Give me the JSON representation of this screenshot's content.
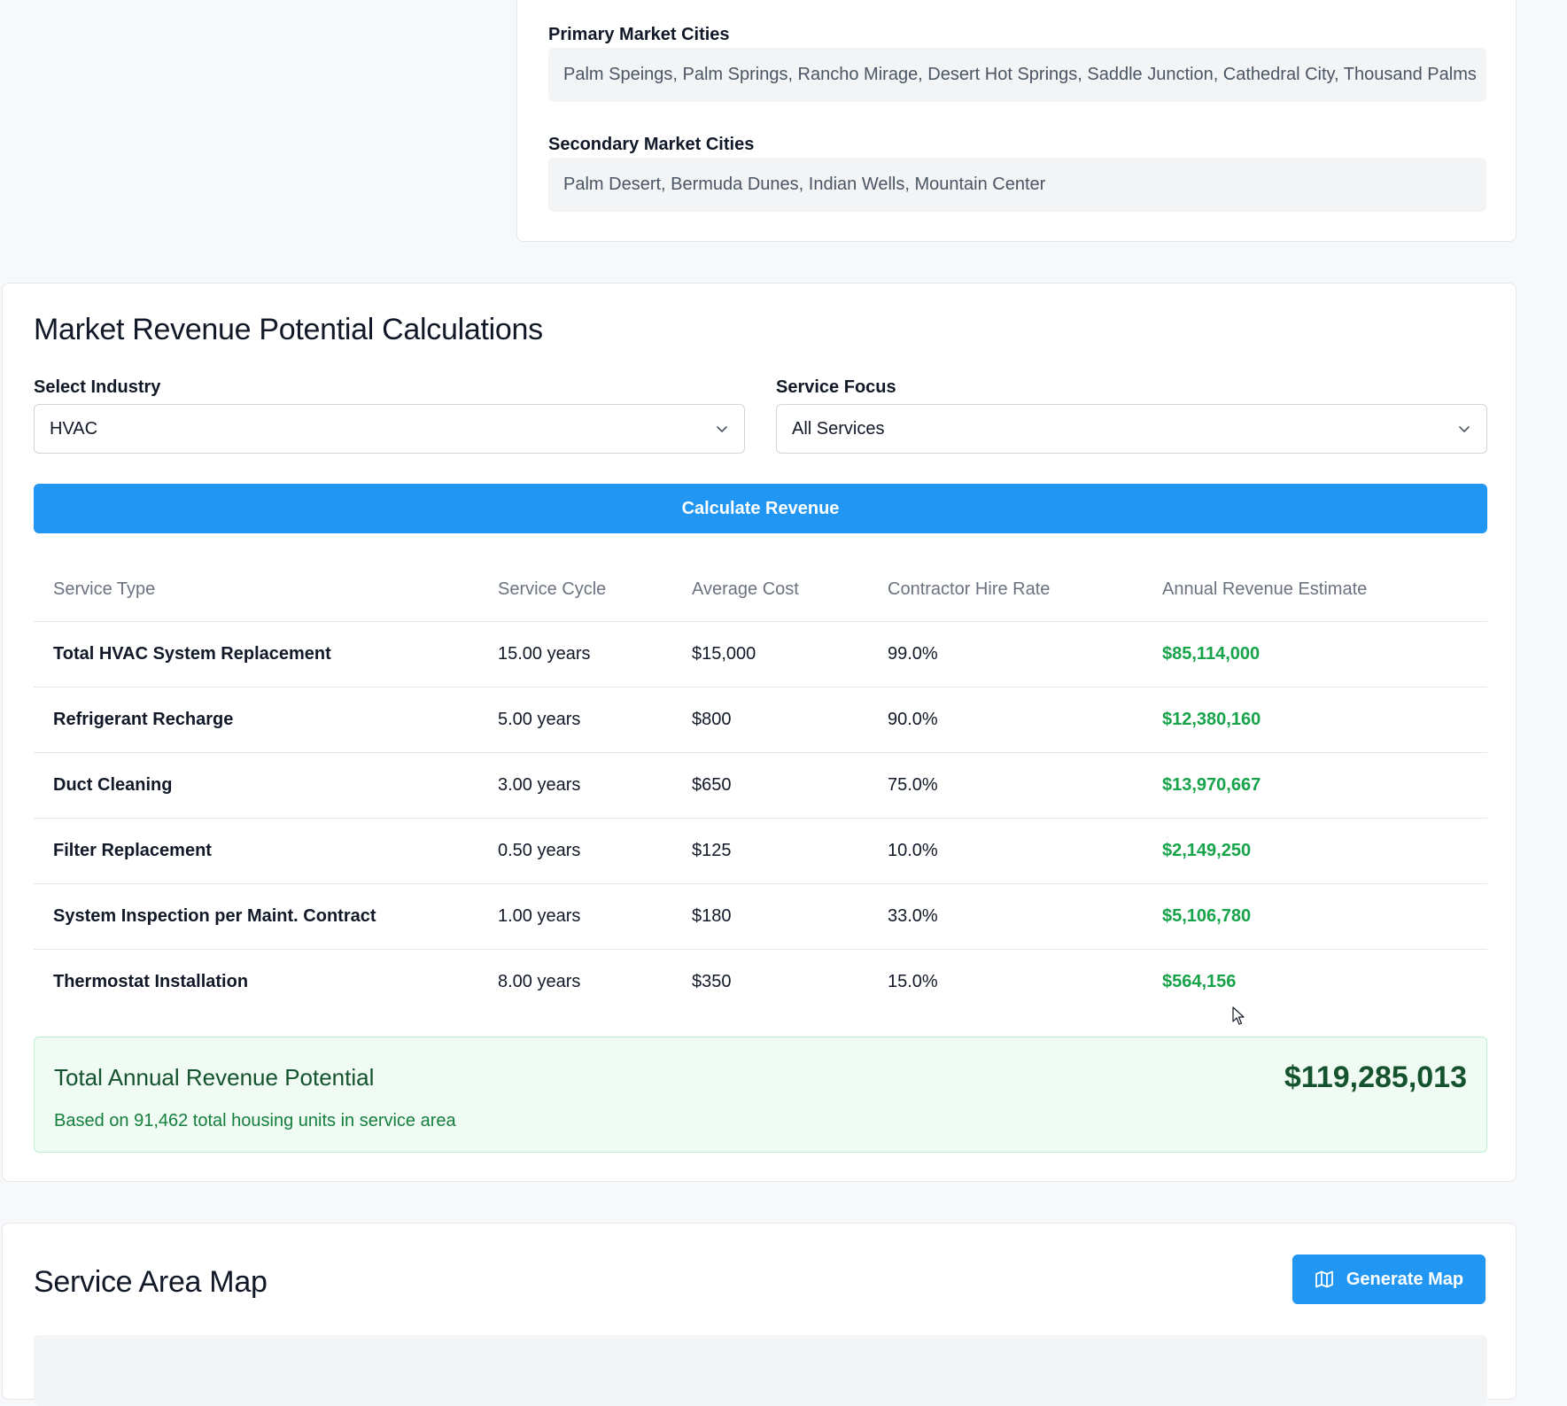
{
  "cities": {
    "primary_label": "Primary Market Cities",
    "primary_value": "Palm Speings, Palm Springs, Rancho Mirage, Desert Hot Springs, Saddle Junction, Cathedral City, Thousand Palms",
    "secondary_label": "Secondary Market Cities",
    "secondary_value": "Palm Desert, Bermuda Dunes, Indian Wells, Mountain Center"
  },
  "revenue": {
    "title": "Market Revenue Potential Calculations",
    "industry_label": "Select Industry",
    "industry_value": "HVAC",
    "focus_label": "Service Focus",
    "focus_value": "All Services",
    "calculate_label": "Calculate Revenue",
    "columns": [
      "Service Type",
      "Service Cycle",
      "Average Cost",
      "Contractor Hire Rate",
      "Annual Revenue Estimate"
    ],
    "rows": [
      {
        "service": "Total HVAC System Replacement",
        "cycle": "15.00 years",
        "cost": "$15,000",
        "rate": "99.0%",
        "estimate": "$85,114,000"
      },
      {
        "service": "Refrigerant Recharge",
        "cycle": "5.00 years",
        "cost": "$800",
        "rate": "90.0%",
        "estimate": "$12,380,160"
      },
      {
        "service": "Duct Cleaning",
        "cycle": "3.00 years",
        "cost": "$650",
        "rate": "75.0%",
        "estimate": "$13,970,667"
      },
      {
        "service": "Filter Replacement",
        "cycle": "0.50 years",
        "cost": "$125",
        "rate": "10.0%",
        "estimate": "$2,149,250"
      },
      {
        "service": "System Inspection per Maint. Contract",
        "cycle": "1.00 years",
        "cost": "$180",
        "rate": "33.0%",
        "estimate": "$5,106,780"
      },
      {
        "service": "Thermostat Installation",
        "cycle": "8.00 years",
        "cost": "$350",
        "rate": "15.0%",
        "estimate": "$564,156"
      }
    ],
    "total_label": "Total Annual Revenue Potential",
    "total_value": "$119,285,013",
    "total_note": "Based on 91,462 total housing units in service area"
  },
  "map": {
    "title": "Service Area Map",
    "generate_label": "Generate Map",
    "generate_icon": "map-icon"
  },
  "colors": {
    "accent": "#2196f3",
    "positive": "#16a34a",
    "total_bg": "#effbf3"
  }
}
